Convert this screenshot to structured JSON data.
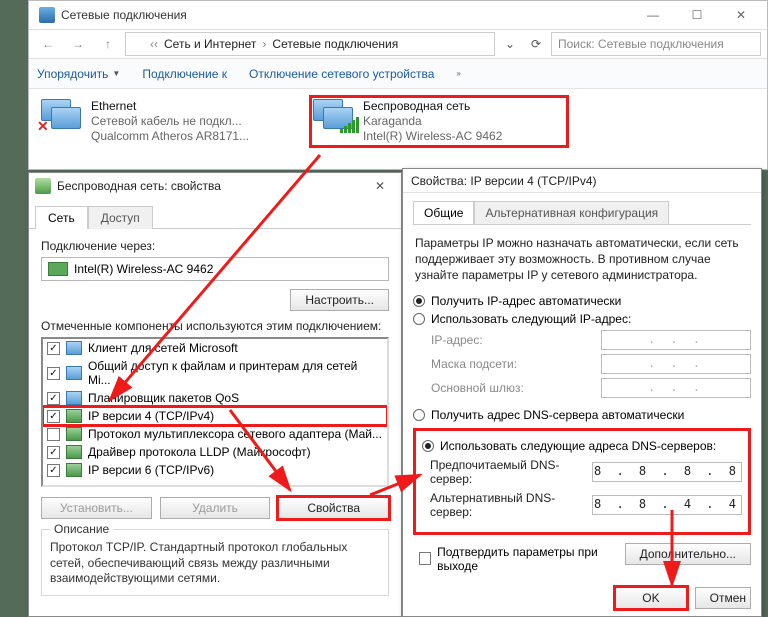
{
  "explorer": {
    "title": "Сетевые подключения",
    "breadcrumb": {
      "a": "Сеть и Интернет",
      "b": "Сетевые подключения"
    },
    "search_placeholder": "Поиск: Сетевые подключения",
    "cmds": {
      "organize": "Упорядочить",
      "connect": "Подключение к",
      "disable": "Отключение сетевого устройства"
    },
    "eth": {
      "name": "Ethernet",
      "line1": "Сетевой кабель не подкл...",
      "line2": "Qualcomm Atheros AR8171..."
    },
    "wifi": {
      "name": "Беспроводная сеть",
      "line1": "Karaganda",
      "line2": "Intel(R) Wireless-AC 9462"
    }
  },
  "wifiprops": {
    "title": "Беспроводная сеть: свойства",
    "tab_net": "Сеть",
    "tab_access": "Доступ",
    "conn_via": "Подключение через:",
    "adapter": "Intel(R) Wireless-AC 9462",
    "configure": "Настроить...",
    "components_lbl": "Отмеченные компоненты используются этим подключением:",
    "components": [
      "Клиент для сетей Microsoft",
      "Общий доступ к файлам и принтерам для сетей Mi...",
      "Планировщик пакетов QoS",
      "IP версии 4 (TCP/IPv4)",
      "Протокол мультиплексора сетевого адаптера (Май...",
      "Драйвер протокола LLDP (Майкрософт)",
      "IP версии 6 (TCP/IPv6)"
    ],
    "install": "Установить...",
    "remove": "Удалить",
    "props": "Свойства",
    "desc_title": "Описание",
    "desc": "Протокол TCP/IP. Стандартный протокол глобальных сетей, обеспечивающий связь между различными взаимодействующими сетями."
  },
  "ipprops": {
    "title": "Свойства: IP версии 4 (TCP/IPv4)",
    "tab_general": "Общие",
    "tab_alt": "Альтернативная конфигурация",
    "hint": "Параметры IP можно назначать автоматически, если сеть поддерживает эту возможность. В противном случае узнайте параметры IP у сетевого администратора.",
    "auto_ip": "Получить IP-адрес автоматически",
    "manual_ip": "Использовать следующий IP-адрес:",
    "ip_lbl": "IP-адрес:",
    "mask_lbl": "Маска подсети:",
    "gw_lbl": "Основной шлюз:",
    "dots": ".   .   .",
    "auto_dns": "Получить адрес DNS-сервера автоматически",
    "manual_dns": "Использовать следующие адреса DNS-серверов:",
    "pref_dns_lbl": "Предпочитаемый DNS-сервер:",
    "alt_dns_lbl": "Альтернативный DNS-сервер:",
    "pref_dns": "8 . 8 . 8 . 8",
    "alt_dns": "8 . 8 . 4 . 4",
    "confirm": "Подтвердить параметры при выходе",
    "advanced": "Дополнительно...",
    "ok": "OK",
    "cancel": "Отмен"
  }
}
